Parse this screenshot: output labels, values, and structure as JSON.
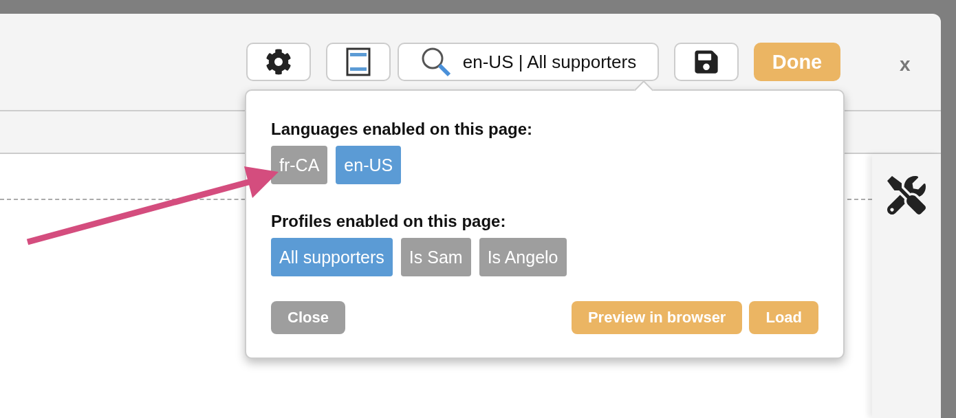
{
  "toolbar": {
    "search_label": "en-US | All supporters",
    "done_label": "Done",
    "close_label": "x"
  },
  "popover": {
    "languages_title": "Languages enabled on this page:",
    "languages": [
      {
        "label": "fr-CA",
        "selected": false
      },
      {
        "label": "en-US",
        "selected": true
      }
    ],
    "profiles_title": "Profiles enabled on this page:",
    "profiles": [
      {
        "label": "All supporters",
        "selected": true
      },
      {
        "label": "Is Sam",
        "selected": false
      },
      {
        "label": "Is Angelo",
        "selected": false
      }
    ],
    "close_label": "Close",
    "preview_label": "Preview in browser",
    "load_label": "Load"
  }
}
